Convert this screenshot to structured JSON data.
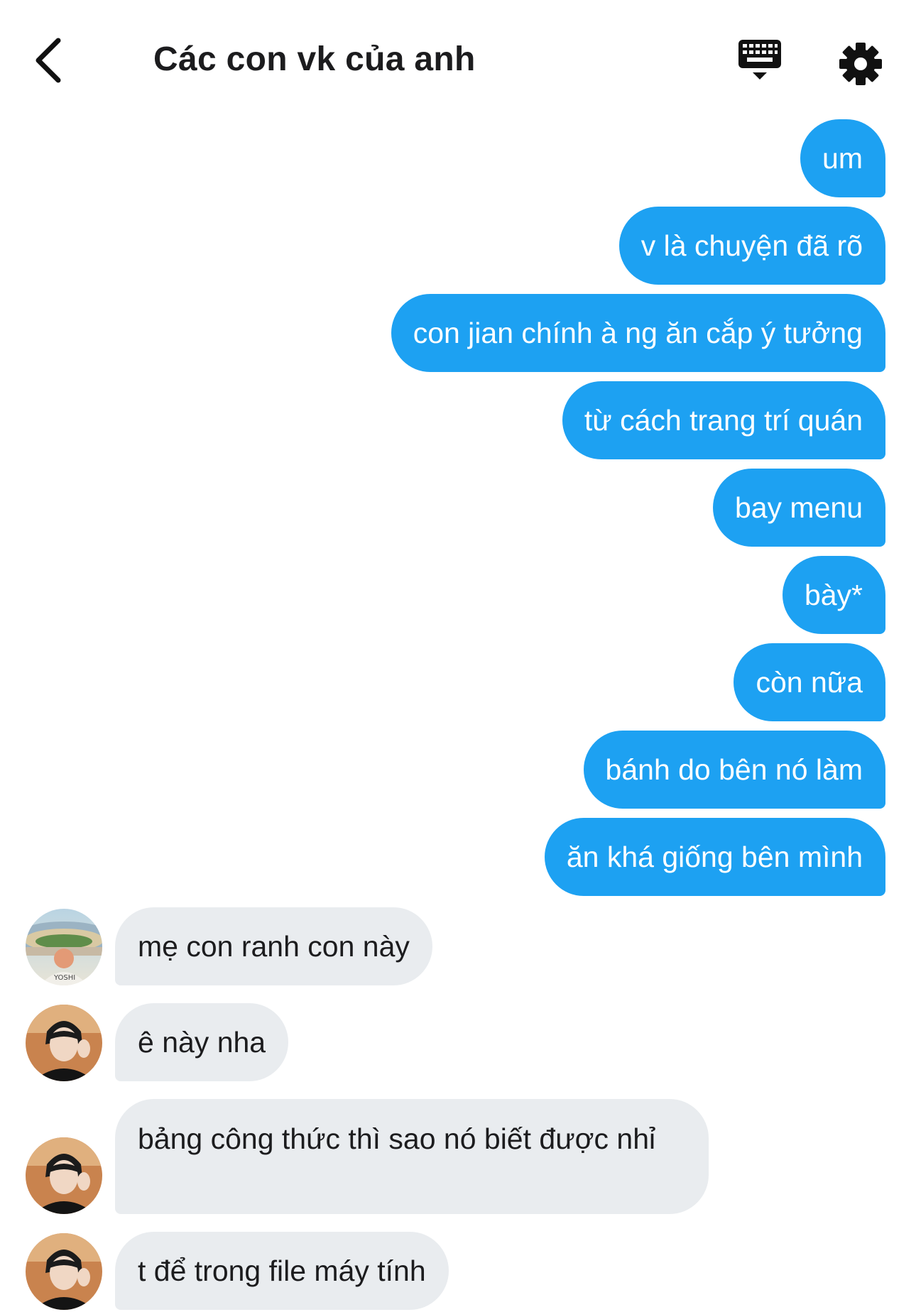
{
  "header": {
    "title": "Các con vk của anh"
  },
  "icons": {
    "back": "chevron-left-icon",
    "keyboard": "keyboard-icon",
    "settings": "gear-icon"
  },
  "colors": {
    "outgoing_bubble": "#1da1f2",
    "incoming_bubble": "#e9ecef",
    "header_text": "#1c1c1e"
  },
  "messages": {
    "outgoing": [
      "um",
      "v là chuyện đã rõ",
      "con jian chính à ng ăn cắp ý tưởng",
      "từ cách trang trí quán",
      "bay menu",
      "bày*",
      "còn nữa",
      "bánh do bên nó làm",
      "ăn khá giống bên mình"
    ],
    "incoming": [
      "mẹ con ranh con này",
      "ê này nha",
      "bảng công thức thì sao nó biết được nhỉ",
      "t để trong file máy tính"
    ]
  },
  "avatars": {
    "first_jersey_text": "YOSHI"
  }
}
